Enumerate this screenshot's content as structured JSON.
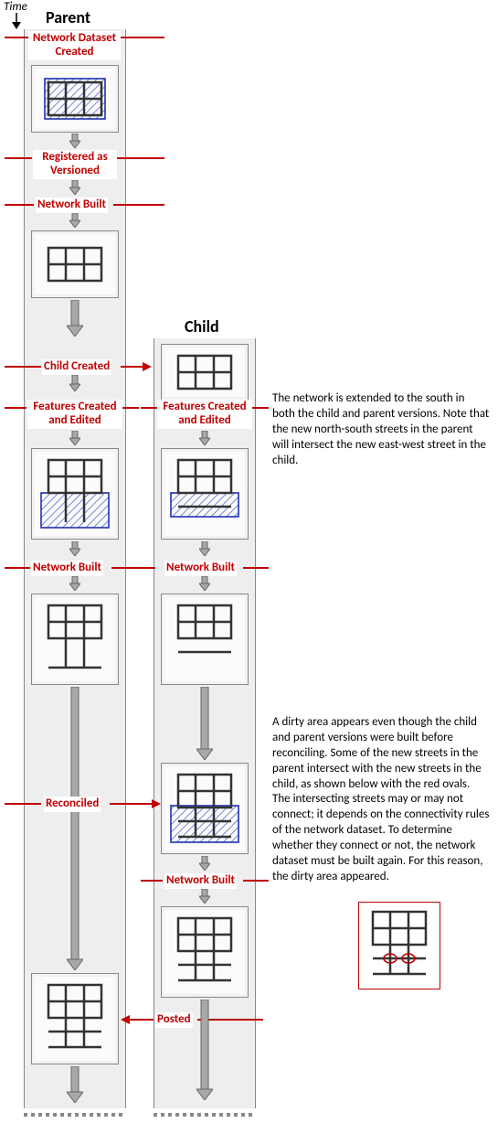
{
  "time_label": "Time",
  "headers": {
    "parent": "Parent",
    "child": "Child"
  },
  "events": {
    "network_dataset_created": "Network Dataset\nCreated",
    "registered_versioned": "Registered as\nVersioned",
    "network_built_1": "Network Built",
    "child_created": "Child Created",
    "features_created_edited_p": "Features Created\nand Edited",
    "features_created_edited_c": "Features Created\nand Edited",
    "network_built_p2": "Network Built",
    "network_built_c2": "Network Built",
    "reconciled": "Reconciled",
    "network_built_c3": "Network Built",
    "posted": "Posted"
  },
  "descriptions": {
    "d1": "The network is extended to the south in both the child and parent versions. Note that the new north-south streets in the parent will intersect the new east-west street in the child.",
    "d2": "A dirty area appears even though the child and parent versions were built before reconciling. Some of the new streets in the parent intersect with the new streets in the child, as shown below with the red ovals. The intersecting streets may or may not connect; it depends on the connectivity rules of the network dataset. To determine whether they connect or not, the network dataset must be built again. For this reason, the dirty area appeared."
  }
}
